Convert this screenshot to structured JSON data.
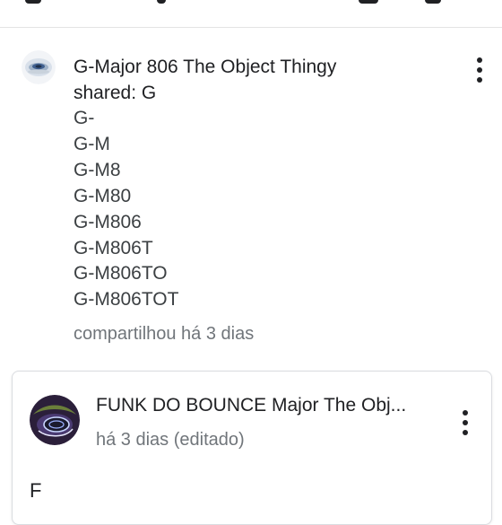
{
  "post": {
    "author": "G-Major 806 The Object Thingy",
    "shared_word": "shared:",
    "shared_text": "G",
    "lines": [
      "G-",
      "G-M",
      "G-M8",
      "G-M80",
      "G-M806",
      "G-M806T",
      "G-M806TO",
      "G-M806TOT"
    ],
    "meta": "compartilhou há 3 dias"
  },
  "card": {
    "title": "FUNK DO BOUNCE Major The Obj...",
    "meta": "há 3 dias (editado)",
    "body": "F"
  },
  "colors": {
    "text": "#202124",
    "secondary": "#70757a",
    "divider": "#e3e3e3"
  }
}
